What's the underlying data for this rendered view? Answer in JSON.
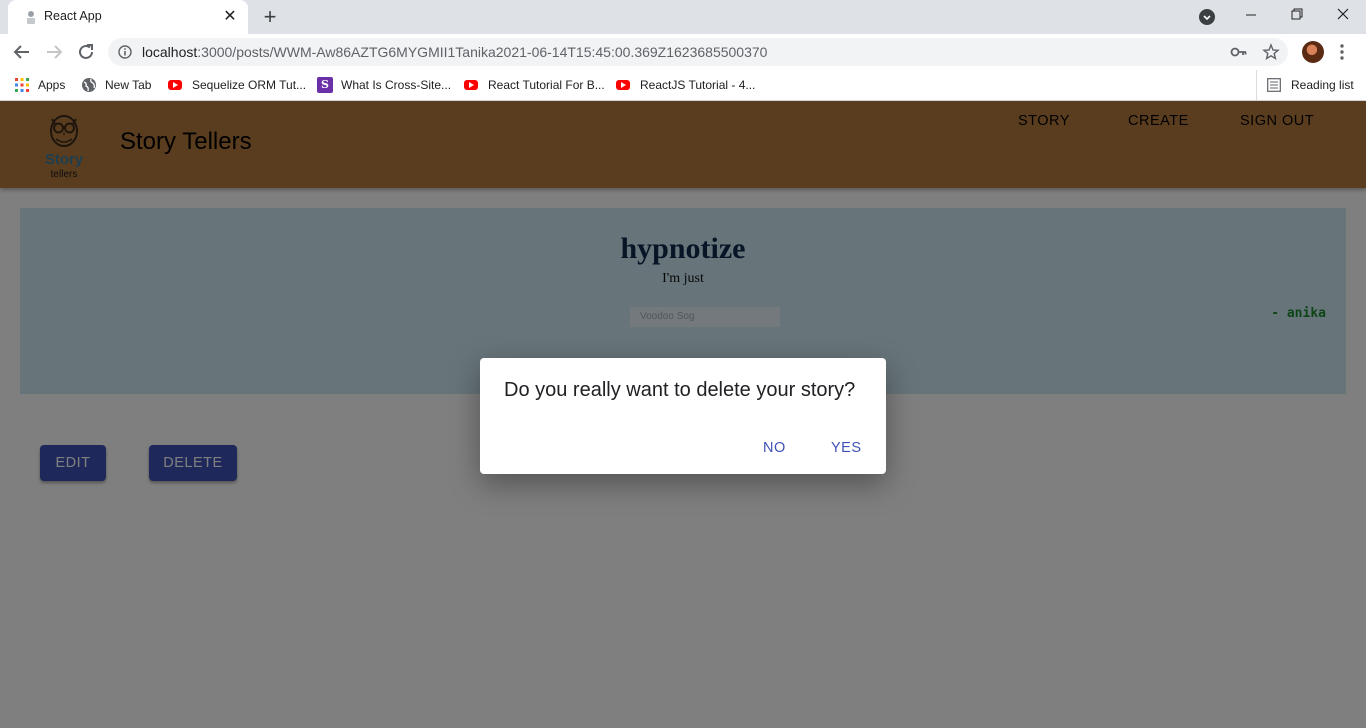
{
  "browser": {
    "tab_title": "React App",
    "url_host": "localhost",
    "url_rest": ":3000/posts/WWM-Aw86AZTG6MYGMII1Tanika2021-06-14T15:45:00.369Z1623685500370",
    "bookmarks": [
      {
        "label": "Apps",
        "icon": "apps-grid-icon"
      },
      {
        "label": "New Tab",
        "icon": "globe-icon"
      },
      {
        "label": "Sequelize ORM Tut...",
        "icon": "youtube-icon"
      },
      {
        "label": "What Is Cross-Site...",
        "icon": "s-icon"
      },
      {
        "label": "React Tutorial For B...",
        "icon": "youtube-icon"
      },
      {
        "label": "ReactJS Tutorial - 4...",
        "icon": "youtube-icon"
      }
    ],
    "reading_list": "Reading list"
  },
  "app": {
    "logo_word1": "Story",
    "logo_word2": "tellers",
    "brand": "Story Tellers",
    "nav": {
      "story": "STORY",
      "create": "CREATE",
      "sign_out": "SIGN OUT"
    },
    "colors": {
      "appbar": "#b57a3e",
      "primary": "#3f51b5",
      "card": "#cfe9f4",
      "author": "#1b8a2e"
    }
  },
  "story": {
    "title": "hypnotize",
    "body": "I'm just",
    "music": "Voodoo Sog",
    "author": "- anika",
    "edit_label": "EDIT",
    "delete_label": "DELETE"
  },
  "dialog": {
    "message": "Do you really want to delete your story?",
    "no_label": "NO",
    "yes_label": "YES"
  }
}
